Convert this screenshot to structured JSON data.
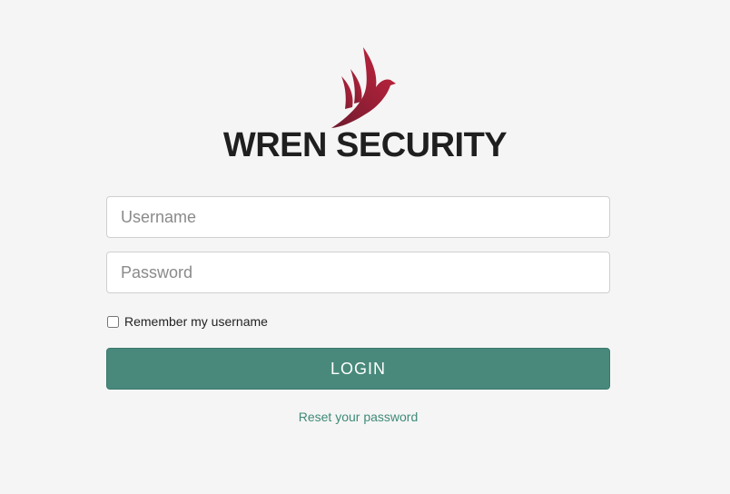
{
  "brand": {
    "name": "WREN SECURITY",
    "logo_icon": "wren-bird-icon",
    "logo_colors": [
      "#7d1d33",
      "#c0243c"
    ]
  },
  "form": {
    "username_placeholder": "Username",
    "username_value": "",
    "password_placeholder": "Password",
    "password_value": "",
    "remember_label": "Remember my username",
    "remember_checked": false,
    "login_label": "LOGIN",
    "reset_link": "Reset your password"
  },
  "colors": {
    "background": "#f5f5f5",
    "primary_button": "#48897b",
    "link": "#3f8a77"
  }
}
